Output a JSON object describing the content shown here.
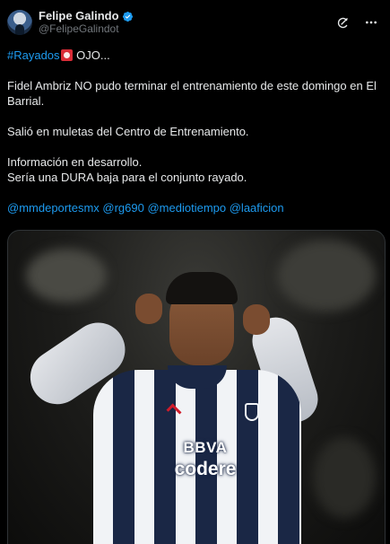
{
  "author": {
    "display_name": "Felipe Galindo",
    "handle": "@FelipeGalindot",
    "verified": true,
    "avatar_icon": "avatar"
  },
  "header_actions": [
    {
      "name": "grok-icon"
    },
    {
      "name": "more-icon"
    }
  ],
  "tweet": {
    "hashtag": "#Rayados",
    "after_hashtag": " OJO...",
    "line1": "Fidel Ambriz NO pudo terminar el entrenamiento de este domingo en El Barrial.",
    "line2": "Salió en muletas del Centro de Entrenamiento.",
    "line3": "Información en desarrollo.",
    "line4": "Sería una DURA baja para el conjunto rayado.",
    "mentions": [
      "@mmdeportesmx",
      "@rg690",
      "@mediotiempo",
      "@laaficion"
    ]
  },
  "media": {
    "jersey_sponsor_1": "BBVA",
    "jersey_sponsor_2": "codere"
  },
  "colors": {
    "background": "#000000",
    "text": "#e7e9ea",
    "secondary_text": "#71767b",
    "link": "#1d9bf0",
    "verified_badge": "#1d9bf0"
  }
}
